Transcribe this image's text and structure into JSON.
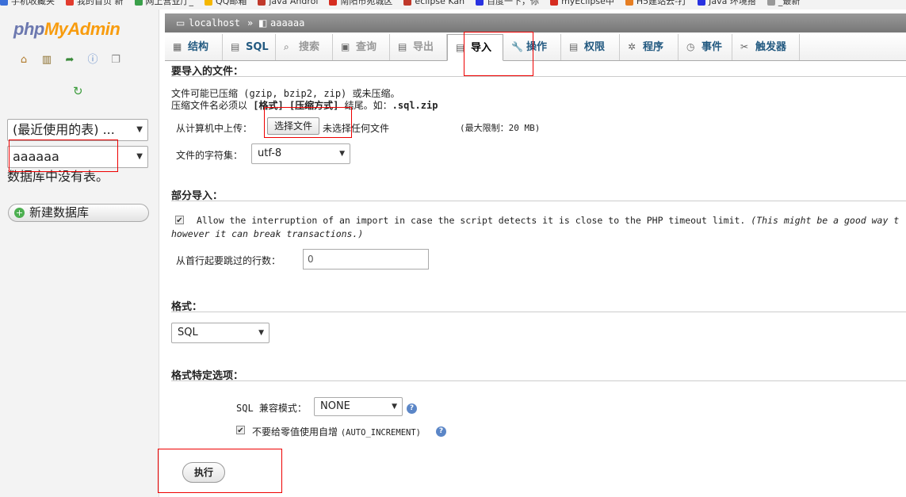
{
  "bookmarks": [
    {
      "label": "手机收藏夹",
      "color": "#3b6fd8"
    },
    {
      "label": "我的首页 新",
      "color": "#e23b2e"
    },
    {
      "label": "网上营业厅_",
      "color": "#3aa04a"
    },
    {
      "label": "QQ邮箱",
      "color": "#f5b700"
    },
    {
      "label": "java Androi",
      "color": "#c0392b"
    },
    {
      "label": "南阳市宛城区",
      "color": "#d62d20"
    },
    {
      "label": "eclipse Kan",
      "color": "#c0392b"
    },
    {
      "label": "百度一下，你",
      "color": "#2932e1"
    },
    {
      "label": "myEclipse中",
      "color": "#d62d20"
    },
    {
      "label": "H5建站云-打",
      "color": "#e67e22"
    },
    {
      "label": "Java 环境搭",
      "color": "#2932e1"
    },
    {
      "label": "_最新",
      "color": "#999999"
    }
  ],
  "sidebar": {
    "logo_php": "php",
    "logo_myadmin": "MyAdmin",
    "icons": [
      "home-icon",
      "exit-icon",
      "query-window-icon",
      "docs-icon",
      "copy-icon"
    ],
    "reload_icon": "reload-icon",
    "recent_tables": "(最近使用的表) ...",
    "database_select": "aaaaaa",
    "no_tables": "数据库中没有表。",
    "new_db_button": "新建数据库"
  },
  "breadcrumb": {
    "server": "localhost",
    "separator": "»",
    "database": "aaaaaa"
  },
  "tabs": [
    {
      "label": "结构",
      "icon": "structure-icon",
      "state": "normal"
    },
    {
      "label": "SQL",
      "icon": "sql-icon",
      "state": "normal"
    },
    {
      "label": "搜索",
      "icon": "search-icon",
      "state": "disabled"
    },
    {
      "label": "查询",
      "icon": "query-icon",
      "state": "disabled"
    },
    {
      "label": "导出",
      "icon": "export-icon",
      "state": "disabled"
    },
    {
      "label": "导入",
      "icon": "import-icon",
      "state": "active"
    },
    {
      "label": "操作",
      "icon": "wrench-icon",
      "state": "normal"
    },
    {
      "label": "权限",
      "icon": "privileges-icon",
      "state": "normal"
    },
    {
      "label": "程序",
      "icon": "routines-icon",
      "state": "normal"
    },
    {
      "label": "事件",
      "icon": "events-icon",
      "state": "normal"
    },
    {
      "label": "触发器",
      "icon": "triggers-icon",
      "state": "normal"
    }
  ],
  "import_file": {
    "title": "要导入的文件：",
    "note1": "文件可能已压缩 (gzip, bzip2, zip) 或未压缩。",
    "note2_prefix": "压缩文件名必须以",
    "note2_format": "[格式]",
    "note2_compress": "[压缩方式]",
    "note2_suffix": "结尾。如：",
    "note2_example": ".sql.zip",
    "upload_label": "从计算机中上传：",
    "choose_file_button": "选择文件",
    "no_file_text": "未选择任何文件",
    "max_limit": "(最大限制：20 MB)",
    "charset_label": "文件的字符集：",
    "charset_value": "utf-8"
  },
  "partial_import": {
    "title": "部分导入：",
    "allow_interrupt_text": "Allow the interruption of an import in case the script detects it is close to the PHP timeout limit.",
    "allow_interrupt_note": "(This might be a good way t",
    "allow_interrupt_note2": "however it can break transactions.)",
    "skip_label": "从首行起要跳过的行数：",
    "skip_value": "0"
  },
  "format": {
    "title": "格式：",
    "value": "SQL"
  },
  "format_options": {
    "title": "格式特定选项：",
    "compat_label": "SQL 兼容模式：",
    "compat_value": "NONE",
    "auto_increment_label": "不要给零值使用自增",
    "auto_increment_code": "(AUTO_INCREMENT)"
  },
  "go_button": "执行",
  "colors": {
    "accent_red": "#ee0000",
    "tab_link": "#235a81",
    "breadcrumb_bg": "#888888"
  }
}
